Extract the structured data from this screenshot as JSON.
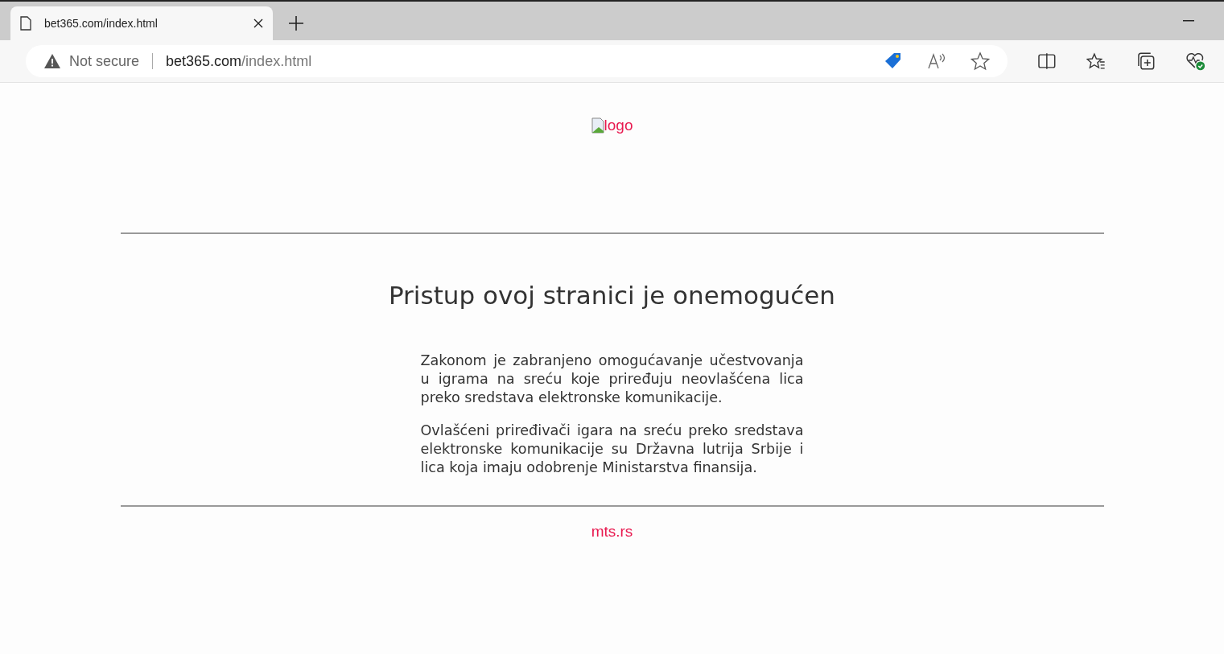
{
  "browser": {
    "tabs": [
      {
        "title": "bet365.com/index.html",
        "selected": true
      }
    ],
    "security": "Not secure",
    "address": {
      "host": "bet365.com",
      "path": "/index.html"
    }
  },
  "page": {
    "logo_alt": "logo",
    "heading": "Pristup ovoj stranici je onemogućen",
    "paragraphs": [
      "Zakonom je zabranjeno omogućavanje učestvovanja u igrama na sreću koje priređuju neovlašćena lica preko sredstava elektronske komunikacije.",
      "Ovlašćeni priređivači igara na sreću preko sredstava elektronske komunikacije su Državna lutrija Srbije i lica koja imaju odobrenje Ministarstva finansija."
    ],
    "footer_link": "mts.rs"
  }
}
